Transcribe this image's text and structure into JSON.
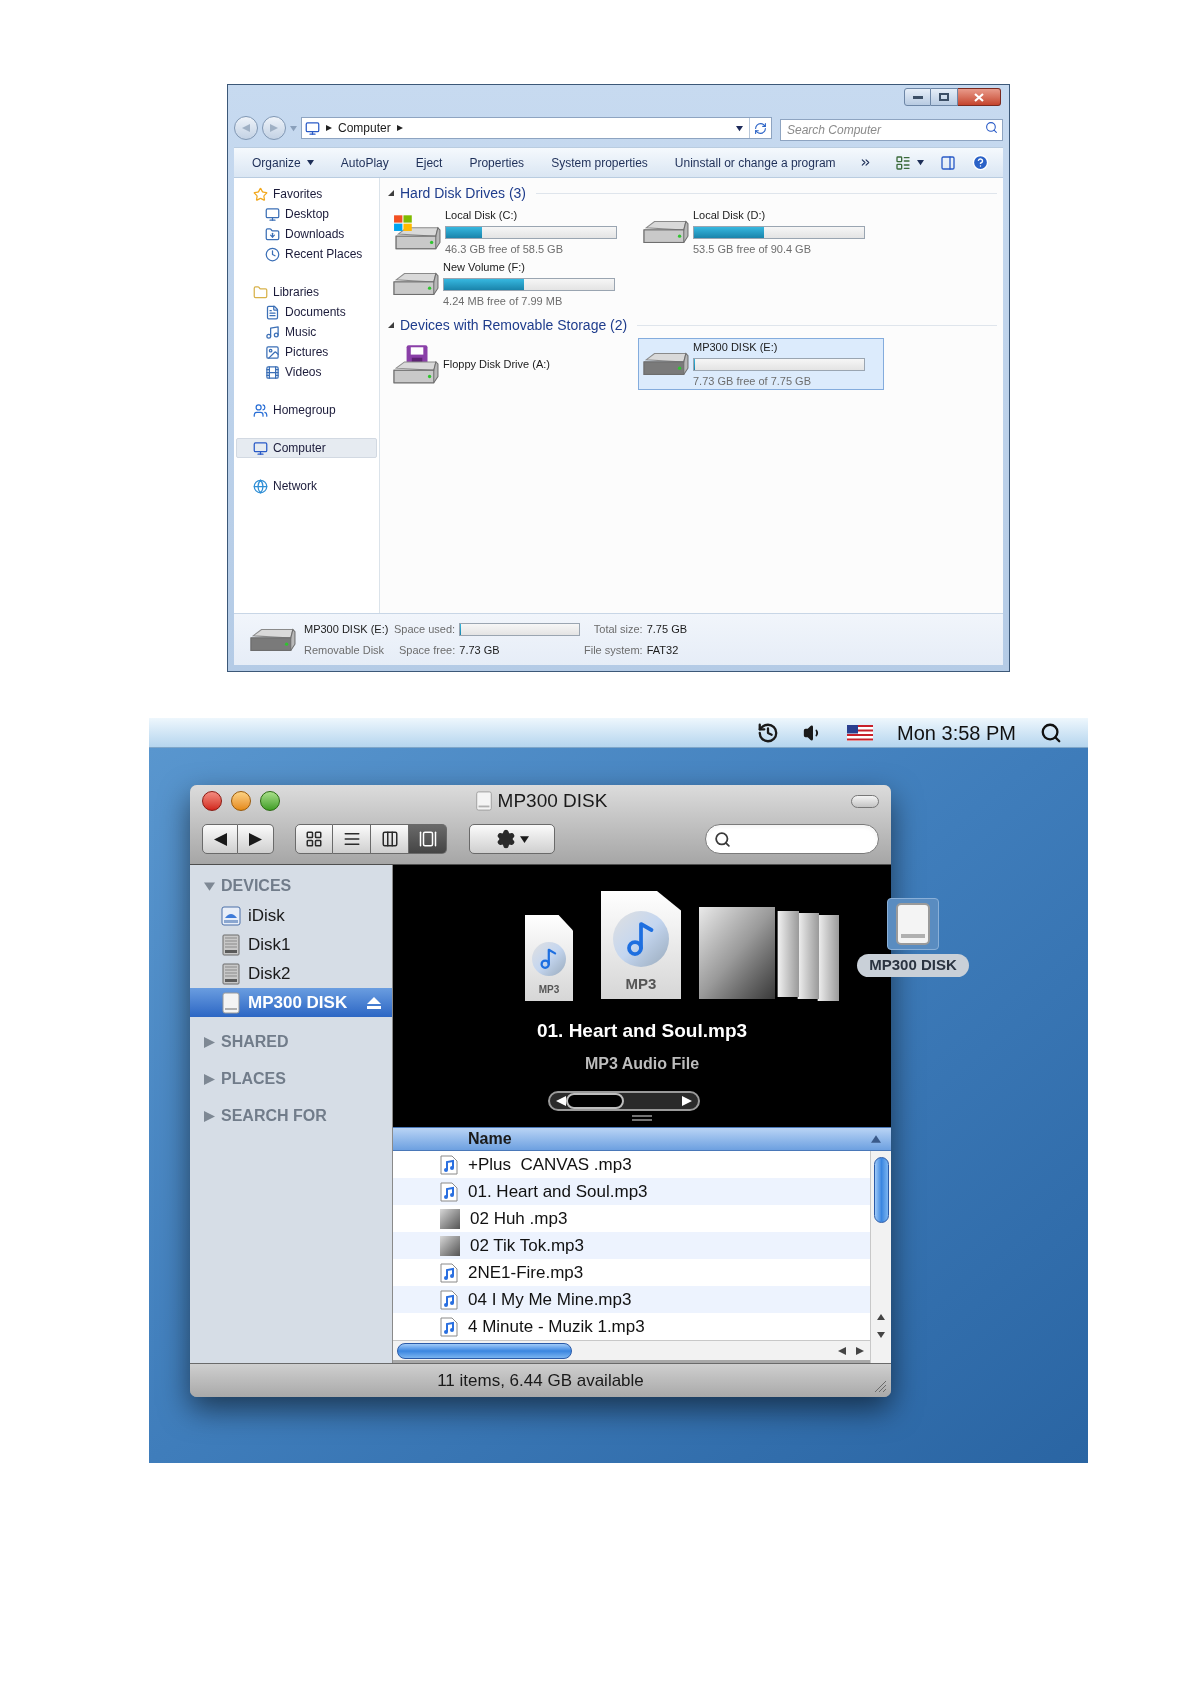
{
  "explorer": {
    "address_bar": {
      "crumbs": [
        "Computer"
      ]
    },
    "search": {
      "placeholder": "Search Computer"
    },
    "commands": [
      {
        "label": "Organize",
        "kind": "menu"
      },
      {
        "label": "AutoPlay",
        "kind": "plain"
      },
      {
        "label": "Eject",
        "kind": "plain"
      },
      {
        "label": "Properties",
        "kind": "plain"
      },
      {
        "label": "System properties",
        "kind": "plain"
      },
      {
        "label": "Uninstall or change a program",
        "kind": "plain"
      }
    ],
    "sidebar": [
      {
        "label": "Favorites",
        "selected": false,
        "children": [
          {
            "label": "Desktop",
            "selected": false
          },
          {
            "label": "Downloads",
            "selected": false
          },
          {
            "label": "Recent Places",
            "selected": false
          }
        ]
      },
      {
        "label": "Libraries",
        "selected": false,
        "children": [
          {
            "label": "Documents",
            "selected": false
          },
          {
            "label": "Music",
            "selected": false
          },
          {
            "label": "Pictures",
            "selected": false
          },
          {
            "label": "Videos",
            "selected": false
          }
        ]
      },
      {
        "label": "Homegroup",
        "selected": false
      },
      {
        "label": "Computer",
        "selected": true
      },
      {
        "label": "Network",
        "selected": false
      }
    ],
    "sections": [
      {
        "title": "Hard Disk Drives (3)",
        "expanded": true,
        "items": [
          {
            "name": "Local Disk (C:)",
            "kind": "system_drive",
            "level": 0.21,
            "reading": "46.3 GB free of 58.5 GB",
            "selected": false
          },
          {
            "name": "Local Disk (D:)",
            "kind": "hard_drive",
            "level": 0.41,
            "reading": "53.5 GB free of 90.4 GB",
            "selected": false
          },
          {
            "name": "New Volume (F:)",
            "kind": "hard_drive",
            "level": 0.47,
            "reading": "4.24 MB free of 7.99 MB",
            "selected": false
          }
        ]
      },
      {
        "title": "Devices with Removable Storage (2)",
        "expanded": true,
        "items": [
          {
            "name": "Floppy Disk Drive (A:)",
            "kind": "floppy",
            "selected": false
          },
          {
            "name": "MP300 DISK (E:)",
            "kind": "removable",
            "level": 0.003,
            "reading": "7.73 GB free of 7.75 GB",
            "selected": true
          }
        ]
      }
    ],
    "details": {
      "name": "MP300 DISK (E:)",
      "type": "Removable Disk",
      "space_used": {
        "label": "Space used:",
        "level": 0.003
      },
      "space_free": {
        "label": "Space free:",
        "value": "7.73 GB"
      },
      "total_size": {
        "label": "Total size:",
        "value": "7.75 GB"
      },
      "file_system": {
        "label": "File system:",
        "value": "FAT32"
      }
    }
  },
  "mac": {
    "menu_bar": {
      "clock": "Mon 3:58 PM"
    },
    "finder": {
      "title": "MP300 DISK",
      "views": [
        {
          "selected": false
        },
        {
          "selected": false
        },
        {
          "selected": false
        },
        {
          "selected": true
        }
      ],
      "sidebar": [
        {
          "label": "DEVICES",
          "expanded": true,
          "items": [
            {
              "label": "iDisk",
              "kind": "idisk",
              "selected": false,
              "eject": false
            },
            {
              "label": "Disk1",
              "kind": "disk",
              "selected": false,
              "eject": false
            },
            {
              "label": "Disk2",
              "kind": "disk",
              "selected": false,
              "eject": false
            },
            {
              "label": "MP300 DISK",
              "kind": "removable",
              "selected": true,
              "eject": true
            }
          ]
        },
        {
          "label": "SHARED",
          "expanded": false
        },
        {
          "label": "PLACES",
          "expanded": false
        },
        {
          "label": "SEARCH FOR",
          "expanded": false
        }
      ],
      "coverflow": {
        "title": "01. Heart and Soul.mp3",
        "subtitle": "MP3 Audio File",
        "covers": [
          {
            "kind": "document",
            "label": "MP3",
            "selected": false
          },
          {
            "kind": "document",
            "label": "MP3",
            "selected": true
          },
          {
            "kind": "artwork",
            "selected": false
          },
          {
            "kind": "blank",
            "selected": false
          },
          {
            "kind": "blank",
            "selected": false
          },
          {
            "kind": "blank",
            "selected": false
          }
        ]
      },
      "list": {
        "column": "Name",
        "rows": [
          {
            "name": "+Plus  CANVAS .mp3",
            "kind": "audio"
          },
          {
            "name": "01. Heart and Soul.mp3",
            "kind": "audio"
          },
          {
            "name": "02 Huh .mp3",
            "kind": "artwork"
          },
          {
            "name": "02 Tik Tok.mp3",
            "kind": "artwork"
          },
          {
            "name": "2NE1-Fire.mp3",
            "kind": "audio"
          },
          {
            "name": "04 I My Me Mine.mp3",
            "kind": "audio"
          },
          {
            "name": "4 Minute - Muzik 1.mp3",
            "kind": "audio"
          }
        ]
      },
      "status": "11 items, 6.44 GB available"
    },
    "desktop_icon": {
      "label": "MP300 DISK"
    }
  }
}
